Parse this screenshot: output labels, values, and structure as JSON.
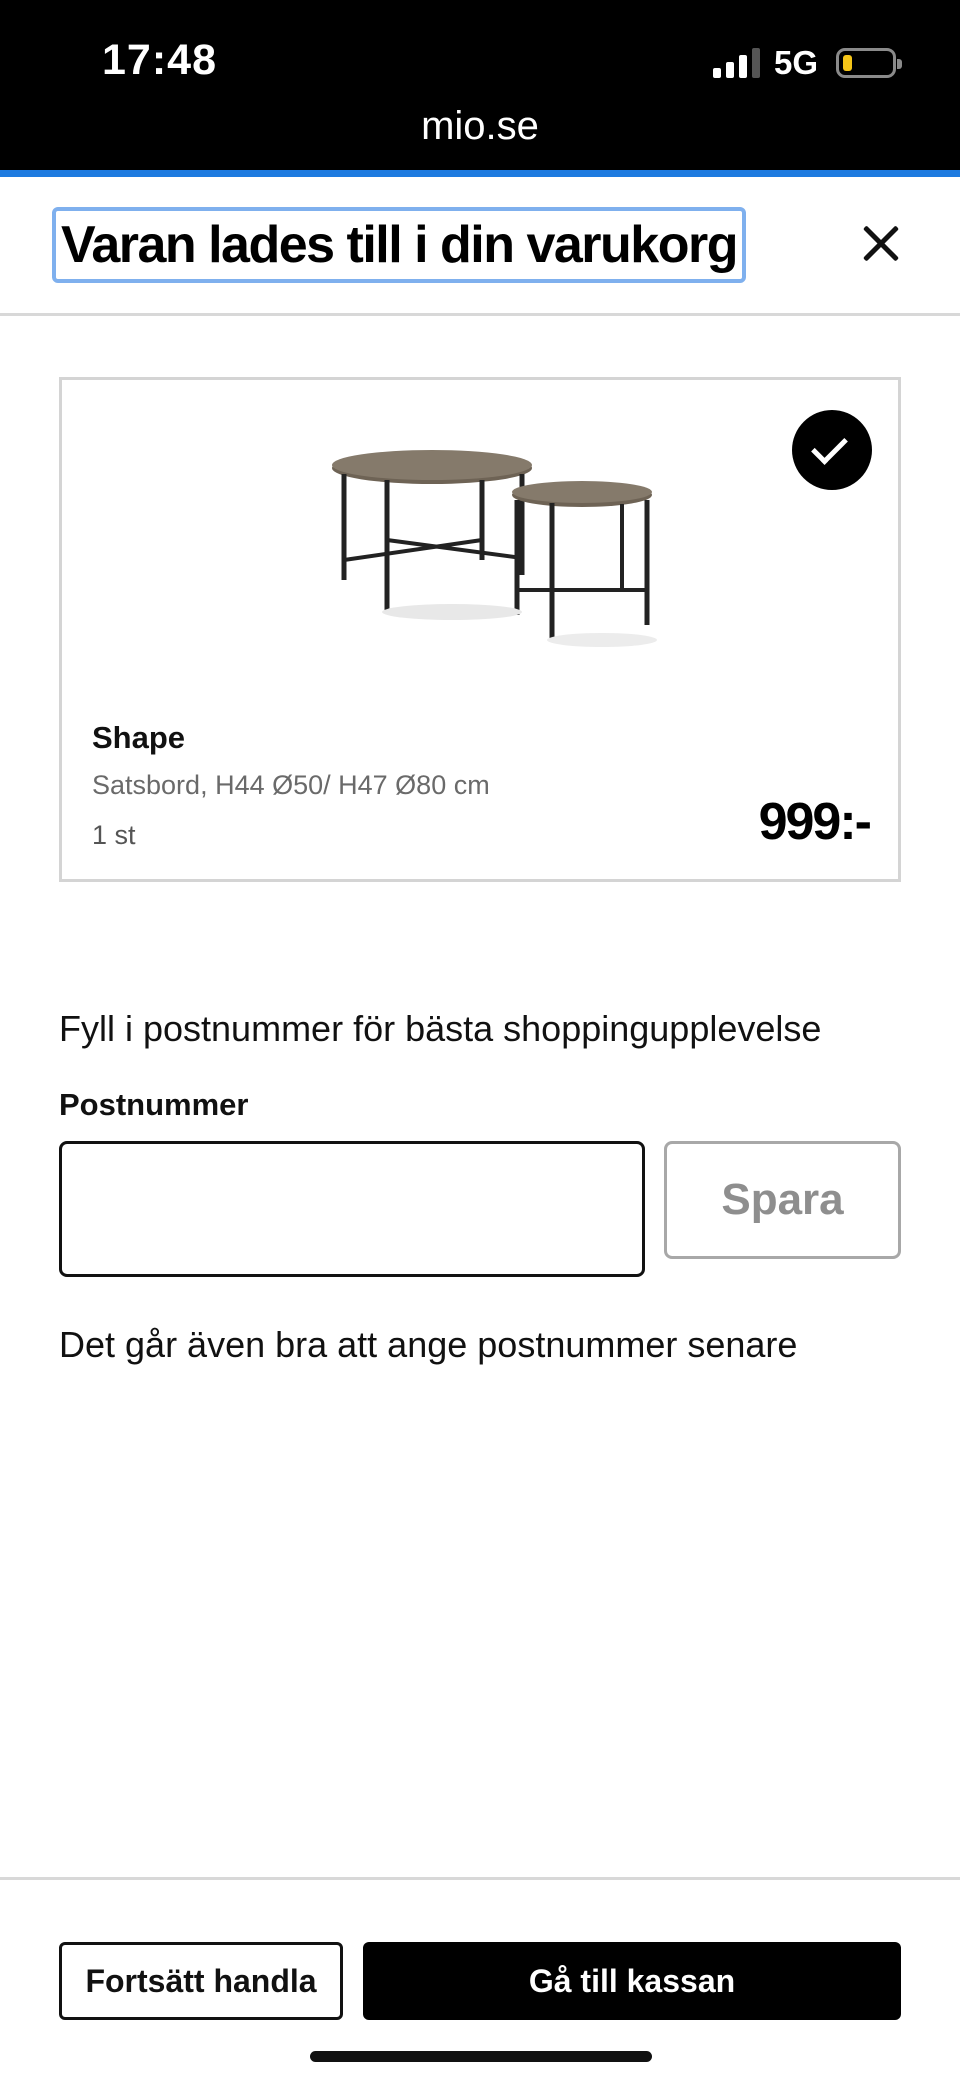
{
  "status_bar": {
    "time": "17:48",
    "network": "5G",
    "signal_bars_active": 3,
    "battery_color": "#f5c518"
  },
  "browser": {
    "url": "mio.se",
    "accent_color": "#1e7be0"
  },
  "header": {
    "title": "Varan lades till i din varukorg",
    "close_icon": "close-icon"
  },
  "product": {
    "name": "Shape",
    "description": "Satsbord, H44 Ø50/ H47 Ø80 cm",
    "quantity": "1 st",
    "price": "999:-",
    "added_icon": "check-icon"
  },
  "postal": {
    "intro": "Fyll i postnummer för bästa shoppingupplevelse",
    "label": "Postnummer",
    "input_value": "",
    "placeholder": "",
    "save_label": "Spara",
    "later_note": "Det går även bra att ange postnummer senare"
  },
  "footer": {
    "continue_label": "Fortsätt handla",
    "checkout_label": "Gå till kassan"
  }
}
